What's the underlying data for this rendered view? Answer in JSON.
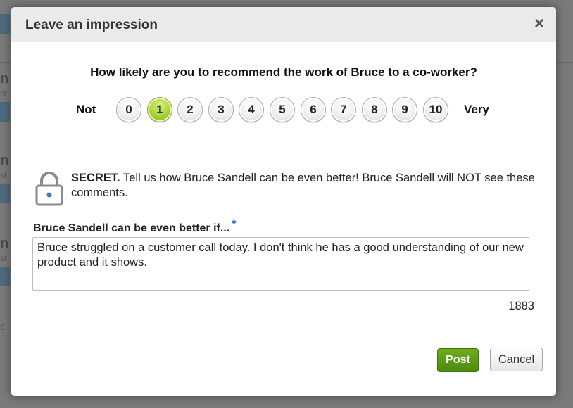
{
  "background": {
    "rows": [
      {
        "letter": "n",
        "sub": "st"
      },
      {
        "letter": "n",
        "sub": "st"
      },
      {
        "letter": "n",
        "sub": "st"
      }
    ],
    "bottom_letter": "c"
  },
  "dialog": {
    "title": "Leave an impression",
    "close_symbol": "×",
    "question": "How likely are you to recommend the work of Bruce to a co-worker?",
    "scale_low_label": "Not",
    "scale_high_label": "Very",
    "rating_options": [
      "0",
      "1",
      "2",
      "3",
      "4",
      "5",
      "6",
      "7",
      "8",
      "9",
      "10"
    ],
    "selected_rating": "1",
    "secret_label": "SECRET.",
    "secret_message": "Tell us how Bruce Sandell can be even better! Bruce Sandell will NOT see these comments.",
    "field_label": "Bruce Sandell can be even better if...",
    "required_marker": "*",
    "comment_text": "Bruce struggled on a customer call today. I don't think he has a good understanding of our new product and it shows.",
    "char_count": "1883",
    "post_label": "Post",
    "cancel_label": "Cancel"
  },
  "icons": {
    "close": "close-icon",
    "lock": "lock-icon"
  },
  "colors": {
    "selected_rating": "#a8d03c",
    "post_button": "#5e9a16",
    "required_marker": "#2a73b8",
    "header_background": "#eaeaea"
  }
}
